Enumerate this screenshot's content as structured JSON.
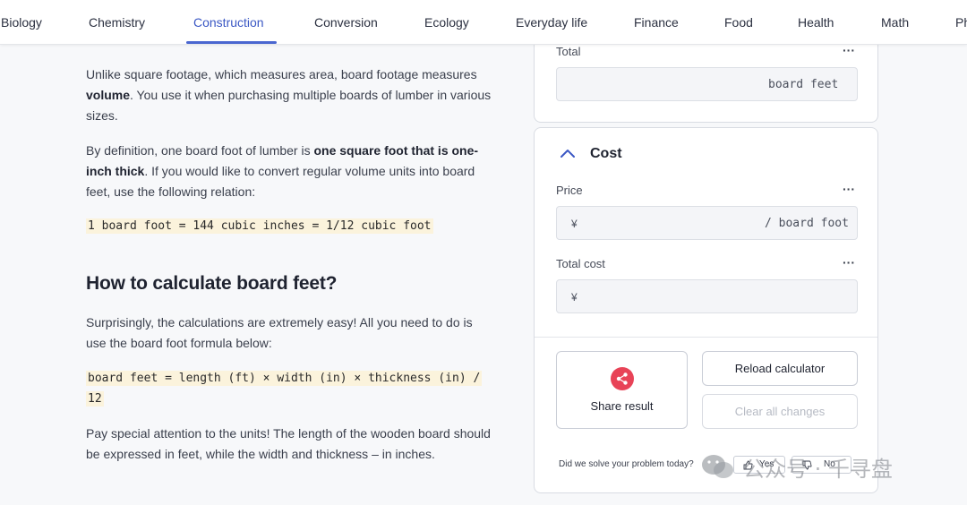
{
  "nav": {
    "items": [
      {
        "label": "Biology"
      },
      {
        "label": "Chemistry"
      },
      {
        "label": "Construction"
      },
      {
        "label": "Conversion"
      },
      {
        "label": "Ecology"
      },
      {
        "label": "Everyday life"
      },
      {
        "label": "Finance"
      },
      {
        "label": "Food"
      },
      {
        "label": "Health"
      },
      {
        "label": "Math"
      },
      {
        "label": "Ph"
      }
    ],
    "active": "Construction",
    "accent_color": "#4a66d0"
  },
  "article": {
    "p1": {
      "a": "Unlike square footage, which measures area, board footage measures ",
      "b": "volume",
      "c": ". You use it when purchasing multiple boards of lumber in various sizes."
    },
    "p2": {
      "a": "By definition, one board foot of lumber is ",
      "b": "one square foot that is one-inch thick",
      "c": ". If you would like to convert regular volume units into board feet, use the following relation:"
    },
    "code1": "1 board foot = 144 cubic inches = 1/12 cubic foot",
    "heading": "How to calculate board feet?",
    "p3": "Surprisingly, the calculations are extremely easy! All you need to do is use the board foot formula below:",
    "code2_line1": "board feet = length (ft) × width (in) × thickness (in) /",
    "code2_line2": "12",
    "p4": "Pay special attention to the units! The length of the wooden board should be expressed in feet, while the width and thickness – in inches."
  },
  "calculator": {
    "total": {
      "label": "Total",
      "unit": "board feet",
      "menu": "···"
    },
    "cost_section": {
      "title": "Cost",
      "icon": "chevron-up-icon"
    },
    "price": {
      "label": "Price",
      "currency": "¥",
      "unit": "/ board foot",
      "menu": "···"
    },
    "total_cost": {
      "label": "Total cost",
      "currency": "¥",
      "menu": "···"
    },
    "share_label": "Share result",
    "reload_label": "Reload calculator",
    "clear_label": "Clear all changes",
    "feedback_question": "Did we solve your problem today?",
    "yes_label": "Yes",
    "no_label": "No"
  },
  "watermark": {
    "text": "公众号 · 千寻盘"
  }
}
